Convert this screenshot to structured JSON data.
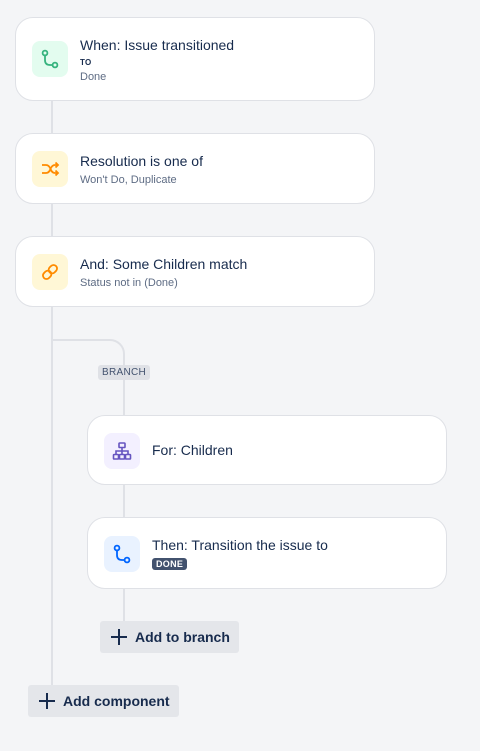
{
  "trigger": {
    "title": "When: Issue transitioned",
    "to_label": "TO",
    "to_value": "Done",
    "icon": "transition-icon"
  },
  "condition_resolution": {
    "title": "Resolution is one of",
    "subtitle": "Won't Do, Duplicate",
    "icon": "shuffle-icon"
  },
  "condition_children": {
    "title": "And: Some Children match",
    "subtitle": "Status not in (Done)",
    "icon": "link-icon"
  },
  "branch": {
    "tag": "BRANCH",
    "for": {
      "title": "For: Children",
      "icon": "hierarchy-icon"
    },
    "action": {
      "title": "Then: Transition the issue to",
      "status": "DONE",
      "icon": "transition-icon"
    },
    "add_label": "Add to branch"
  },
  "add_component_label": "Add component",
  "colors": {
    "green_icon": "#36b37e",
    "green_bg": "#e3fcef",
    "orange_icon": "#ff8b00",
    "yellow_bg": "#fff7d6",
    "purple_icon": "#6554c0",
    "purple_bg": "#f3f0ff",
    "blue_icon": "#0065ff",
    "blue_bg": "#e9f2ff"
  }
}
